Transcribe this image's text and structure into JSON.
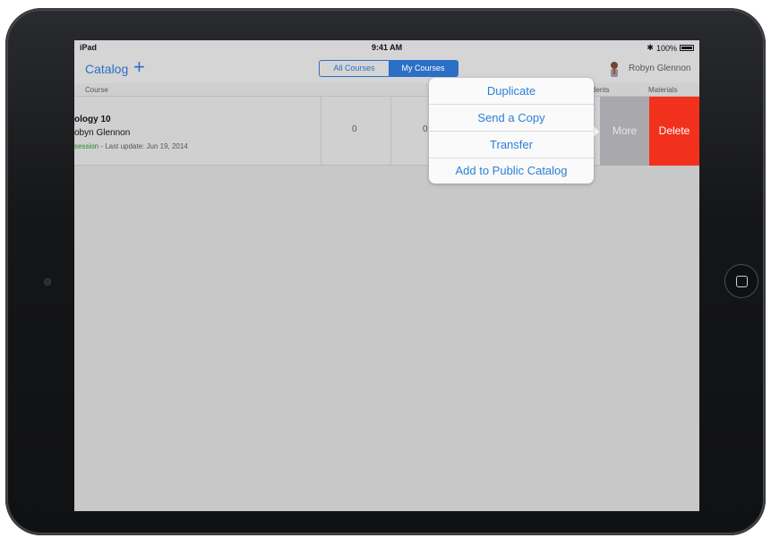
{
  "status_bar": {
    "carrier": "iPad",
    "time": "9:41 AM",
    "battery": "100%"
  },
  "nav": {
    "title": "Catalog",
    "add_icon": "plus-icon",
    "segments": [
      "All Courses",
      "My Courses"
    ],
    "active_segment": "My Courses",
    "user_name": "Robyn Glennon"
  },
  "table": {
    "headers": {
      "course": "Course",
      "students": "dents",
      "materials": "Materials"
    },
    "rows": [
      {
        "title": "ology 10",
        "teacher": "obyn Glennon",
        "status": "session",
        "meta": " - Last update: Jun 19, 2014",
        "col1": "0",
        "col2": "0"
      }
    ]
  },
  "swipe_actions": {
    "more": "More",
    "delete": "Delete"
  },
  "popover": {
    "items": [
      "Duplicate",
      "Send a Copy",
      "Transfer",
      "Add to Public Catalog"
    ]
  },
  "colors": {
    "accent": "#2b6fc7",
    "delete": "#f2311d",
    "more": "#a9a9ad",
    "status_green": "#1f8b25"
  }
}
